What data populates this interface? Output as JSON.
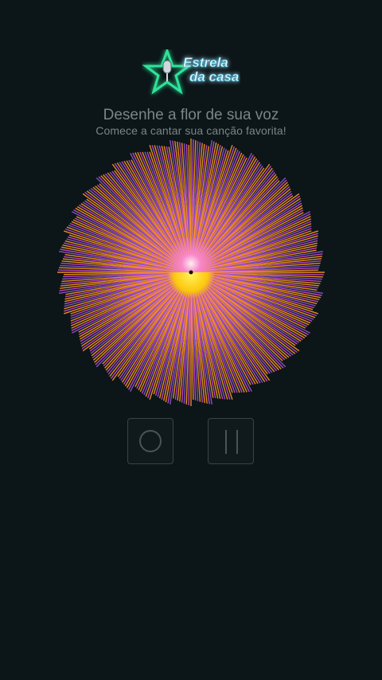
{
  "logo": {
    "line1": "Estrela",
    "line2": "da casa",
    "star_color": "#2de39a",
    "text_color": "#e9f7ff",
    "icon": "microphone-icon"
  },
  "header": {
    "title": "Desenhe a flor de sua voz",
    "subtitle": "Comece a cantar sua canção favorita!"
  },
  "visualizer": {
    "colors": {
      "orange": "#ff9a1f",
      "magenta": "#d24bd6",
      "violet": "#8a5cd0",
      "center_yellow": "#ffe600",
      "center_pink": "#ff8ad8"
    }
  },
  "controls": {
    "record_icon": "record-icon",
    "pause_icon": "pause-icon"
  }
}
